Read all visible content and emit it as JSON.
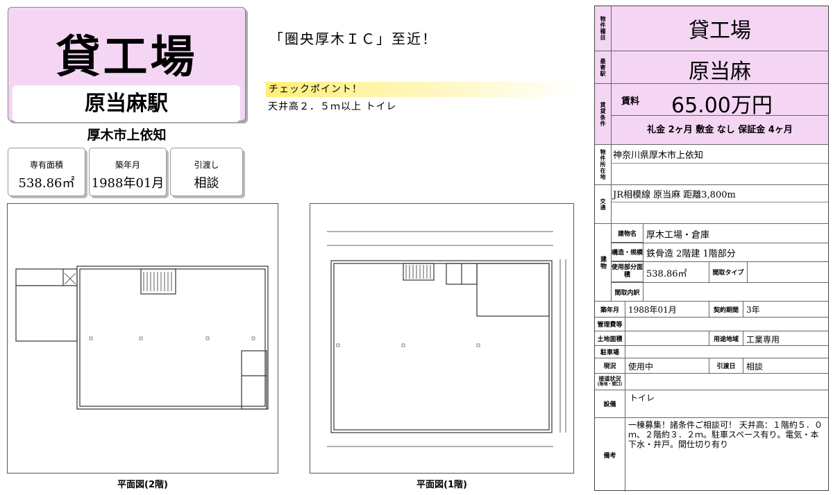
{
  "title": {
    "main": "貸工場",
    "station": "原当麻駅"
  },
  "address_short": "厚木市上依知",
  "info_cards": [
    {
      "label": "専有面積",
      "value": "538.86㎡"
    },
    {
      "label": "築年月",
      "value": "1988年01月"
    },
    {
      "label": "引渡し",
      "value": "相談"
    }
  ],
  "headline": "「圏央厚木ＩＣ」至近！",
  "checkpoint": {
    "title": "チェックポイント！",
    "text": "天井高２．５ｍ以上 トイレ"
  },
  "plans": [
    {
      "caption": "平面図(2階)"
    },
    {
      "caption": "平面図(1階)"
    }
  ],
  "sheet": {
    "type_label": "物件種目",
    "type_value": "貸工場",
    "station_label": "最寄駅",
    "station_value": "原当麻",
    "rent_label": "賃貸条件",
    "rent_sub": "賃料",
    "rent_value": "65.00万円",
    "fees": "礼金 2ヶ月  敷金 なし  保証金 4ヶ月",
    "location_label": "物件所在地",
    "location_value": "神奈川県厚木市上依知",
    "transport_label": "交通",
    "transport_value": "JR相模線 原当麻 距離3,800m",
    "building_label": "建物",
    "bname_label": "建物名",
    "bname_value": "厚木工場・倉庫",
    "struct_label": "構造・規模",
    "struct_value": "鉄骨造 2階建 1階部分",
    "area_label": "使用部分面積",
    "area_value": "538.86㎡",
    "layout_type_label": "間取タイプ",
    "layout_detail_label": "間取内訳",
    "built_label": "築年月",
    "built_value": "1988年01月",
    "contract_label": "契約期間",
    "contract_value": "3年",
    "mgmt_label": "管理費等",
    "land_label": "土地面積",
    "zoning_label": "用途地域",
    "zoning_value": "工業専用",
    "parking_label": "駐車場",
    "status_label": "現況",
    "status_value": "使用中",
    "handover_label": "引渡日",
    "handover_value": "相談",
    "road_label": "接道状況",
    "road_sub": "(角地・間口)",
    "equip_label": "設備",
    "equip_value": "トイレ",
    "remarks_label": "備考",
    "remarks_value": "一棟募集！諸条件ご相談可！ 天井高：１階約５．０ｍ、２階約３．２ｍ。駐車スペース有り。電気・本下水・井戸。間仕切り有り"
  }
}
